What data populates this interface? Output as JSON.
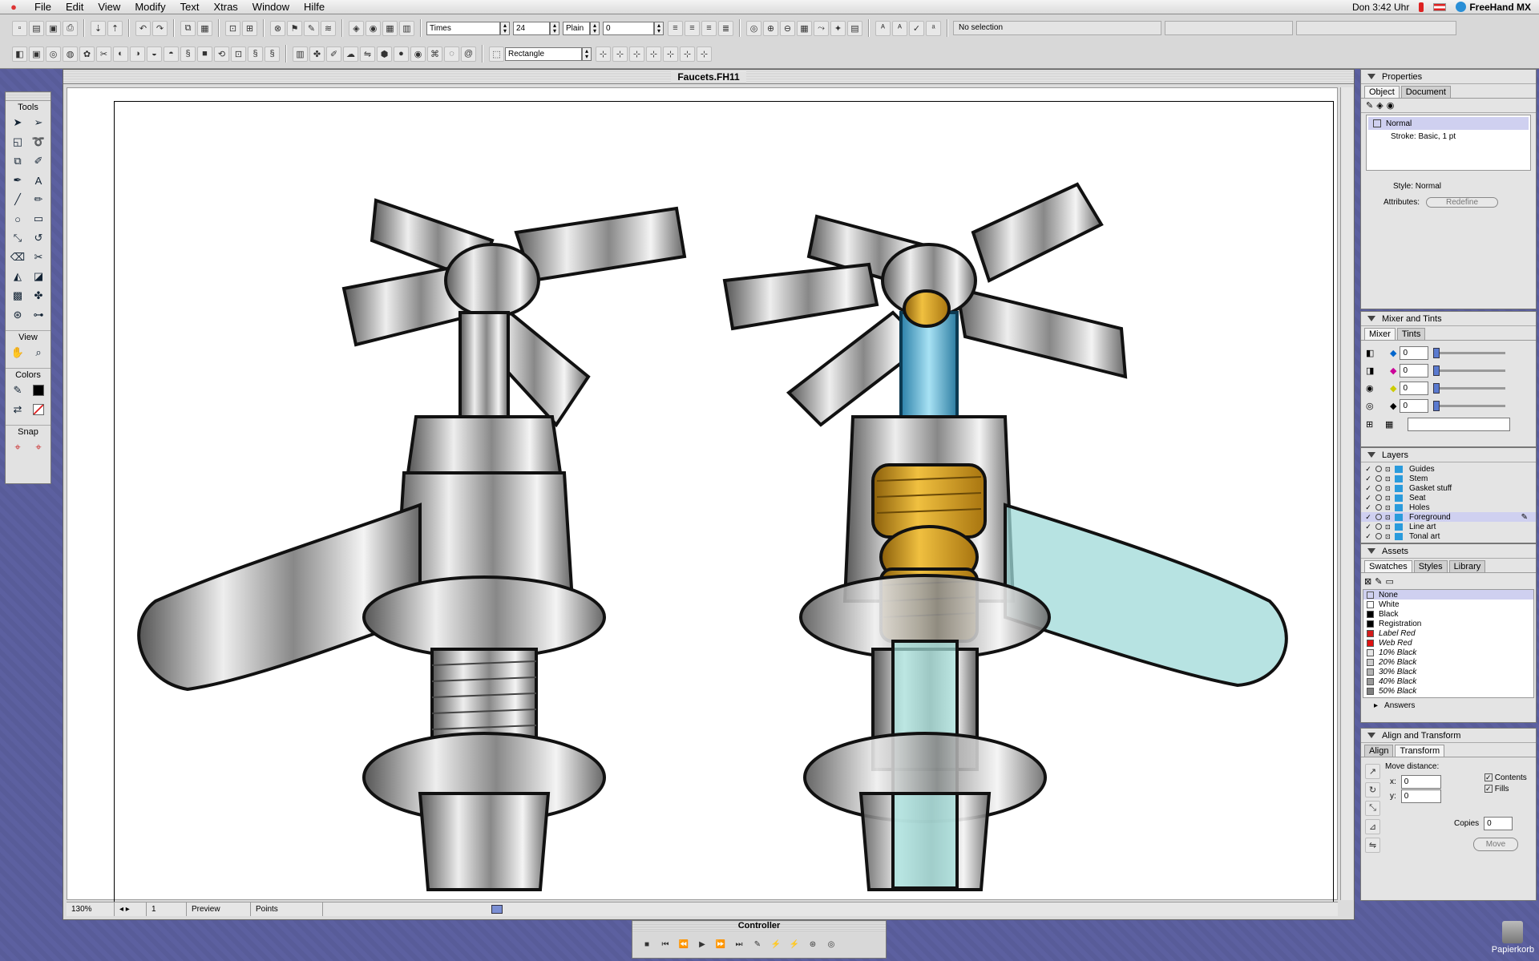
{
  "menubar": {
    "items": [
      "File",
      "Edit",
      "View",
      "Modify",
      "Text",
      "Xtras",
      "Window",
      "Hilfe"
    ],
    "clock": "Don 3:42 Uhr",
    "app_name": "FreeHand MX"
  },
  "toolbar": {
    "font_name": "Times",
    "font_size": "24",
    "font_style": "Plain",
    "tracking": "0",
    "status": "No selection",
    "shape_tool": "Rectangle"
  },
  "tools": {
    "title": "Tools",
    "view_label": "View",
    "colors_label": "Colors",
    "snap_label": "Snap"
  },
  "document": {
    "title": "Faucets.FH11",
    "zoom": "130%",
    "page": "1",
    "view_mode": "Preview",
    "units": "Points"
  },
  "properties": {
    "title": "Properties",
    "tabs": [
      "Object",
      "Document"
    ],
    "items": [
      "Normal",
      "Stroke: Basic, 1 pt"
    ],
    "style_label": "Style:",
    "style_value": "Normal",
    "attributes_label": "Attributes:",
    "redefine": "Redefine"
  },
  "mixer": {
    "title": "Mixer and Tints",
    "tabs": [
      "Mixer",
      "Tints"
    ],
    "values": [
      "0",
      "0",
      "0",
      "0"
    ]
  },
  "layers": {
    "title": "Layers",
    "items": [
      "Guides",
      "Stem",
      "Gasket stuff",
      "Seat",
      "Holes",
      "Foreground",
      "Line art",
      "Tonal art"
    ],
    "selected": "Foreground"
  },
  "assets": {
    "title": "Assets",
    "tabs": [
      "Swatches",
      "Styles",
      "Library"
    ],
    "swatches": [
      {
        "name": "None",
        "color": "#ffffff"
      },
      {
        "name": "White",
        "color": "#ffffff"
      },
      {
        "name": "Black",
        "color": "#000000"
      },
      {
        "name": "Registration",
        "color": "#000000"
      },
      {
        "name": "Label Red",
        "color": "#d41a1a"
      },
      {
        "name": "Web Red",
        "color": "#e01010"
      },
      {
        "name": "10% Black",
        "color": "#e6e6e6"
      },
      {
        "name": "20% Black",
        "color": "#cccccc"
      },
      {
        "name": "30% Black",
        "color": "#b3b3b3"
      },
      {
        "name": "40% Black",
        "color": "#999999"
      },
      {
        "name": "50% Black",
        "color": "#808080"
      }
    ],
    "answers": "Answers"
  },
  "align": {
    "title": "Align and Transform",
    "tabs": [
      "Align",
      "Transform"
    ],
    "move_distance": "Move distance:",
    "x_label": "x:",
    "x_value": "0",
    "y_label": "y:",
    "y_value": "0",
    "contents": "Contents",
    "fills": "Fills",
    "copies_label": "Copies",
    "copies_value": "0",
    "move": "Move"
  },
  "controller": {
    "title": "Controller"
  },
  "desktop": {
    "trash_label": "Papierkorb"
  },
  "colors": {
    "desktop": "#5a5e9c",
    "accent": "#2a9bdc",
    "brass": "#c9961e",
    "glass": "#8fd3d6"
  }
}
